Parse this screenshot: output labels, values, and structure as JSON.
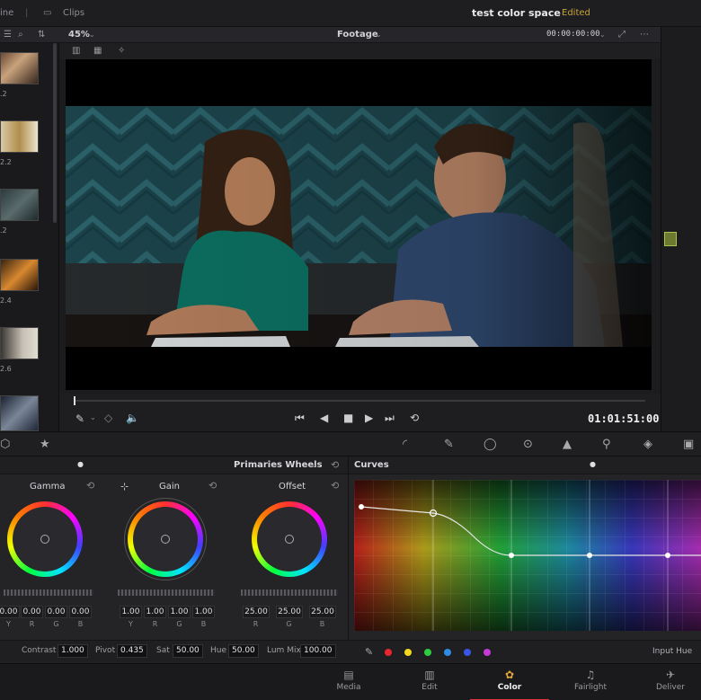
{
  "topbar": {
    "left_fragment": "ine",
    "clips_label": "Clips",
    "project_title": "test color space",
    "project_status": "Edited"
  },
  "viewer_toolbar": {
    "zoom": "45%",
    "view_mode": "Footage",
    "timecode_top": "00:00:00:00"
  },
  "thumbnails": [
    {
      "label": ".2"
    },
    {
      "label": "2.2"
    },
    {
      "label": ".2"
    },
    {
      "label": "2.4"
    },
    {
      "label": "2.6"
    },
    {
      "label": ""
    }
  ],
  "transport": {
    "timecode": "01:01:51:00"
  },
  "wheels": {
    "mode": "Primaries Wheels",
    "items": [
      {
        "title": "Gamma",
        "values": [
          "0.00",
          "0.00",
          "0.00",
          "0.00"
        ],
        "channels": [
          "Y",
          "R",
          "G",
          "B"
        ]
      },
      {
        "title": "Gain",
        "values": [
          "1.00",
          "1.00",
          "1.00",
          "1.00"
        ],
        "channels": [
          "Y",
          "R",
          "G",
          "B"
        ]
      },
      {
        "title": "Offset",
        "values": [
          "25.00",
          "25.00",
          "25.00"
        ],
        "channels": [
          "R",
          "G",
          "B"
        ]
      }
    ]
  },
  "params": {
    "contrast_label": "Contrast",
    "contrast_value": "1.000",
    "pivot_label": "Pivot",
    "pivot_value": "0.435",
    "sat_label": "Sat",
    "sat_value": "50.00",
    "hue_label": "Hue",
    "hue_value": "50.00",
    "lummix_label": "Lum Mix",
    "lummix_value": "100.00"
  },
  "curves": {
    "title": "Curves",
    "input_hue_label": "Input Hue",
    "channel_colors": [
      "#e8262e",
      "#f2d81c",
      "#2ecc40",
      "#2f8de4",
      "#3a56e8",
      "#c73ad8"
    ]
  },
  "pages": [
    {
      "label": "Media",
      "icon": "media-icon"
    },
    {
      "label": "Edit",
      "icon": "edit-icon"
    },
    {
      "label": "Color",
      "icon": "color-icon",
      "active": true
    },
    {
      "label": "Fairlight",
      "icon": "fairlight-icon"
    },
    {
      "label": "Deliver",
      "icon": "deliver-icon"
    }
  ]
}
